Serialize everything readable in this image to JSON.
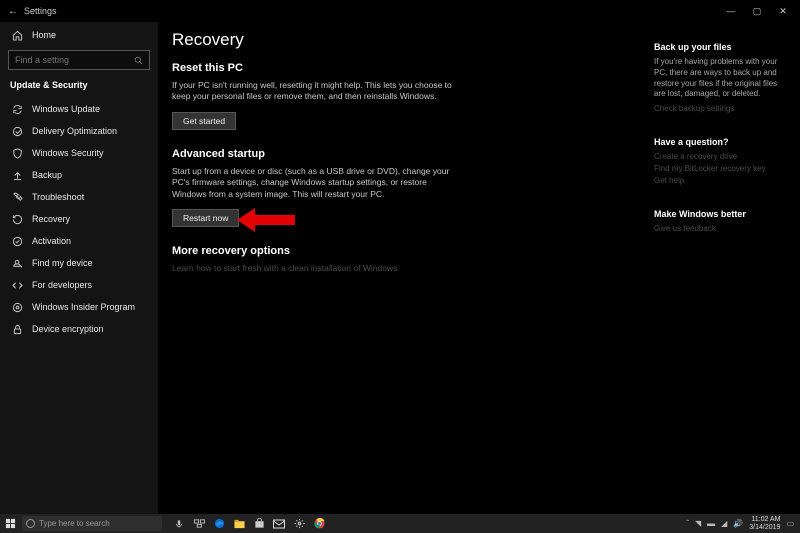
{
  "window": {
    "title": "Settings",
    "min": "—",
    "max": "▢",
    "close": "✕"
  },
  "sidebar": {
    "home": "Home",
    "search_placeholder": "Find a setting",
    "group_header": "Update & Security",
    "items": [
      {
        "icon": "sync",
        "label": "Windows Update"
      },
      {
        "icon": "delivery",
        "label": "Delivery Optimization"
      },
      {
        "icon": "shield",
        "label": "Windows Security"
      },
      {
        "icon": "backup",
        "label": "Backup"
      },
      {
        "icon": "wrench",
        "label": "Troubleshoot"
      },
      {
        "icon": "recovery",
        "label": "Recovery"
      },
      {
        "icon": "check",
        "label": "Activation"
      },
      {
        "icon": "find",
        "label": "Find my device"
      },
      {
        "icon": "dev",
        "label": "For developers"
      },
      {
        "icon": "insider",
        "label": "Windows Insider Program"
      },
      {
        "icon": "lock",
        "label": "Device encryption"
      }
    ]
  },
  "page": {
    "title": "Recovery",
    "reset": {
      "heading": "Reset this PC",
      "desc": "If your PC isn't running well, resetting it might help. This lets you choose to keep your personal files or remove them, and then reinstalls Windows.",
      "button": "Get started"
    },
    "advanced": {
      "heading": "Advanced startup",
      "desc": "Start up from a device or disc (such as a USB drive or DVD), change your PC's firmware settings, change Windows startup settings, or restore Windows from a system image. This will restart your PC.",
      "button": "Restart now"
    },
    "more": {
      "heading": "More recovery options",
      "link": "Learn how to start fresh with a clean installation of Windows"
    }
  },
  "rail": {
    "backup": {
      "heading": "Back up your files",
      "desc": "If you're having problems with your PC, there are ways to back up and restore your files if the original files are lost, damaged, or deleted.",
      "link": "Check backup settings"
    },
    "question": {
      "heading": "Have a question?",
      "links": [
        "Create a recovery drive",
        "Find my BitLocker recovery key",
        "Get help"
      ]
    },
    "better": {
      "heading": "Make Windows better",
      "link": "Give us feedback"
    }
  },
  "taskbar": {
    "search": "Type here to search",
    "time": "11:02 AM",
    "date": "3/14/2019"
  }
}
